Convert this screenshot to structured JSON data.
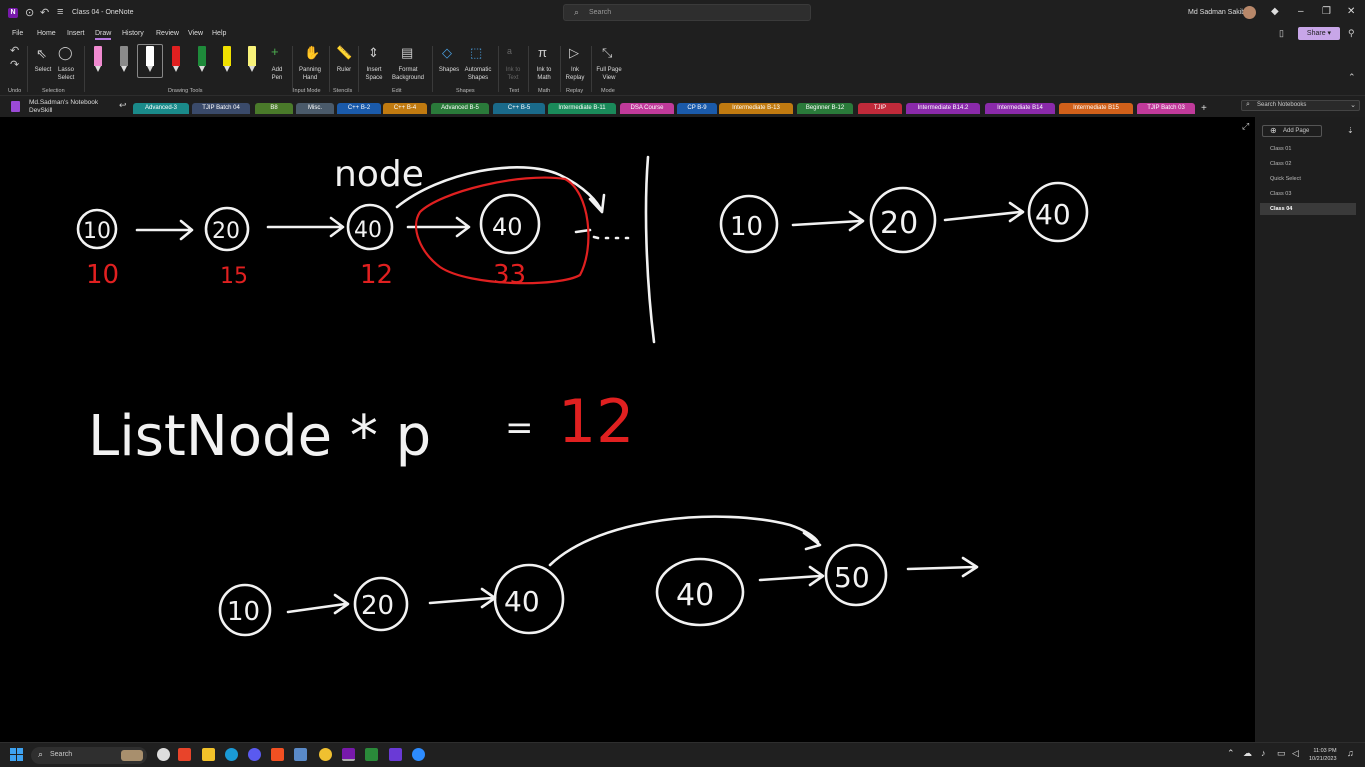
{
  "titlebar": {
    "doc_title": "Class 04 - OneNote",
    "search_placeholder": "Search",
    "user_name": "Md Sadman Sakib"
  },
  "menu": {
    "items": [
      "File",
      "Home",
      "Insert",
      "Draw",
      "History",
      "Review",
      "View",
      "Help"
    ],
    "active": "Draw",
    "share_label": "Share"
  },
  "ribbon": {
    "undo_label": "Undo",
    "select_label": "Select",
    "lasso_label": "Lasso Select",
    "add_pen_label": "Add Pen",
    "panning_label": "Panning Hand",
    "ruler_label": "Ruler",
    "insert_space_label": "Insert Space",
    "format_bg_label": "Format Background",
    "shapes_label": "Shapes",
    "auto_shapes_label": "Automatic Shapes",
    "ink_to_text_label": "Ink to Text",
    "ink_to_math_label": "Ink to Math",
    "ink_replay_label": "Ink Replay",
    "full_page_label": "Full Page View",
    "groups": {
      "undo": "Undo",
      "selection": "Selection",
      "drawing_tools": "Drawing Tools",
      "input_mode": "Input Mode",
      "stencils": "Stencils",
      "edit": "Edit",
      "shapes": "Shapes",
      "text": "Text",
      "math": "Math",
      "replay": "Replay",
      "mode": "Mode"
    },
    "pens": [
      {
        "color": "#f08ad0"
      },
      {
        "color": "#8a8a8a"
      },
      {
        "color": "#ffffff"
      },
      {
        "color": "#e02020"
      },
      {
        "color": "#1e8a3a"
      },
      {
        "color": "#f0e000"
      },
      {
        "color": "#f8f27a"
      }
    ]
  },
  "notebook": {
    "name": "Md.Sadman's Notebook",
    "subname": "DevSkill",
    "search_placeholder": "Search Notebooks"
  },
  "sections": [
    {
      "label": "Advanced-3",
      "color": "#1a8a8a"
    },
    {
      "label": "TJIP Batch 04",
      "color": "#3a4a6a"
    },
    {
      "label": "B8",
      "color": "#4a7a2a"
    },
    {
      "label": "Misc.",
      "color": "#4a5a6a"
    },
    {
      "label": "C++ B-2",
      "color": "#1a5aaa"
    },
    {
      "label": "C++ B-4",
      "color": "#c07a10"
    },
    {
      "label": "Advanced B-5",
      "color": "#2a7a3a"
    },
    {
      "label": "C++ B-5",
      "color": "#1a6a8a"
    },
    {
      "label": "Intermediate B-11",
      "color": "#1a8a5a"
    },
    {
      "label": "DSA Course",
      "color": "#c03a9a"
    },
    {
      "label": "CP B-9",
      "color": "#1a5aaa"
    },
    {
      "label": "Intermediate B-13",
      "color": "#c07a10"
    },
    {
      "label": "Beginner B-12",
      "color": "#2a7a3a"
    },
    {
      "label": "TJIP",
      "color": "#c02a3a"
    },
    {
      "label": "Intermediate B14.2",
      "color": "#8a2aaa"
    },
    {
      "label": "Intermediate B14",
      "color": "#8a2aaa"
    },
    {
      "label": "Intermediate B15",
      "color": "#d0601a"
    },
    {
      "label": "TJIP Batch 03",
      "color": "#c03a9a"
    }
  ],
  "pages": {
    "add_label": "Add Page",
    "items": [
      "Class 01",
      "Class 02",
      "Quick Select",
      "Class 03",
      "Class 04"
    ],
    "active_index": 4
  },
  "ink": {
    "top_labels": {
      "node": "node",
      "n1": "10",
      "n2": "20",
      "n3": "40",
      "n4": "40"
    },
    "red_values": [
      "10",
      "15",
      "12",
      "33"
    ],
    "right_nodes": [
      "10",
      "20",
      "40"
    ],
    "code_text": "ListNode *  p",
    "code_eq": "=",
    "code_val": "12",
    "bottom_nodes": [
      "10",
      "20",
      "40",
      "40",
      "50"
    ]
  },
  "taskbar": {
    "search_label": "Search",
    "time": "11:03 PM",
    "date": "10/21/2023"
  }
}
